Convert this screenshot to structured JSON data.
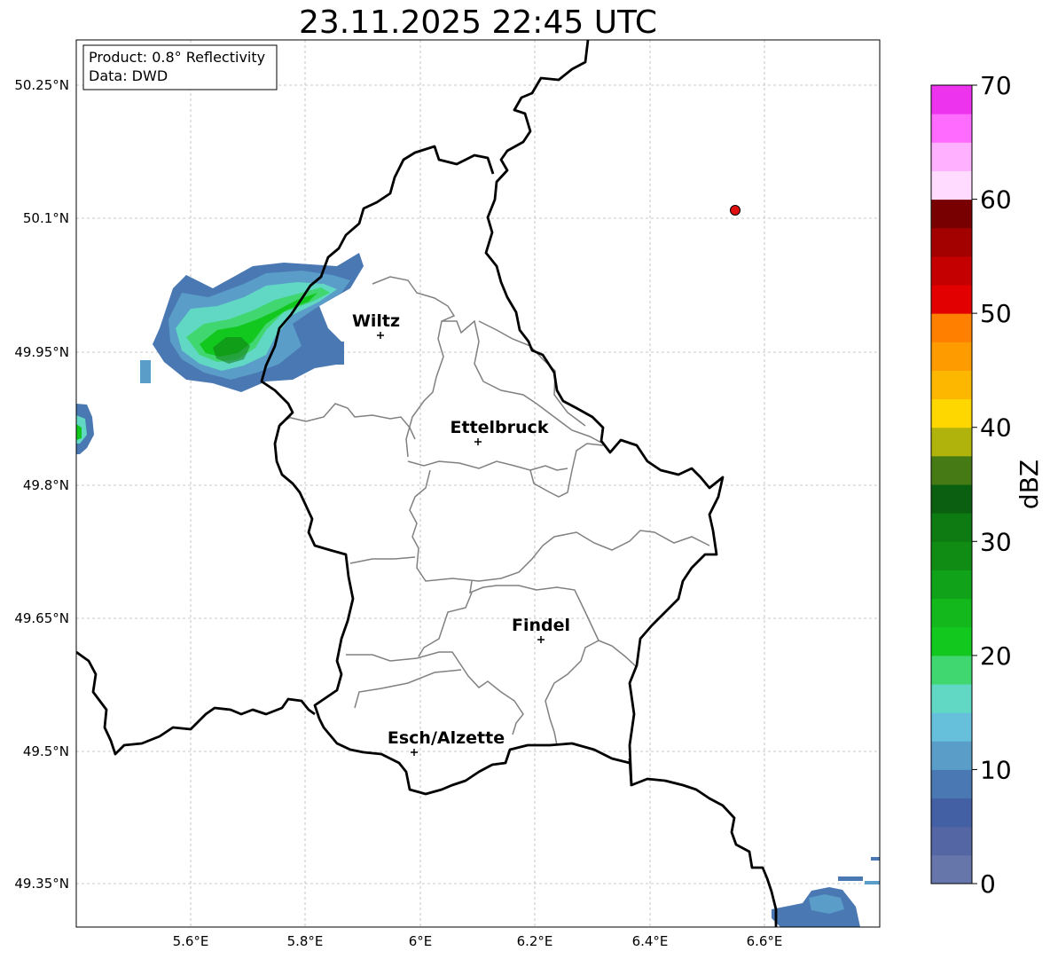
{
  "title": "23.11.2025 22:45 UTC",
  "info_box": {
    "product": "Product: 0.8° Reflectivity",
    "data": "Data: DWD"
  },
  "lat_labels": [
    "50.25°N",
    "50.1°N",
    "49.95°N",
    "49.8°N",
    "49.65°N",
    "49.5°N",
    "49.35°N"
  ],
  "lon_labels": [
    "5.6°E",
    "5.8°E",
    "6°E",
    "6.2°E",
    "6.4°E",
    "6.6°E"
  ],
  "cities": [
    {
      "name": "Wiltz"
    },
    {
      "name": "Ettelbruck"
    },
    {
      "name": "Findel"
    },
    {
      "name": "Esch/Alzette"
    }
  ],
  "colorbar": {
    "label": "dBZ",
    "ticks": [
      "0",
      "10",
      "20",
      "30",
      "40",
      "50",
      "60",
      "70"
    ],
    "colors": [
      "#6675aa",
      "#5466a3",
      "#4460a4",
      "#4a78b3",
      "#5a9dc8",
      "#66c0dc",
      "#60d8c4",
      "#40d670",
      "#12c81e",
      "#12b81c",
      "#10a218",
      "#108c14",
      "#0e7a12",
      "#0a6010",
      "#467a14",
      "#afb30c",
      "#ffd700",
      "#fdb700",
      "#fe9b00",
      "#ff7f00",
      "#e20000",
      "#c40000",
      "#a30000",
      "#790000",
      "#ffdcff",
      "#ffb0ff",
      "#ff6aff",
      "#ee33ee"
    ]
  },
  "colors": {
    "country_border": "#000000",
    "district_border": "#808080",
    "marker": "#e01010"
  }
}
